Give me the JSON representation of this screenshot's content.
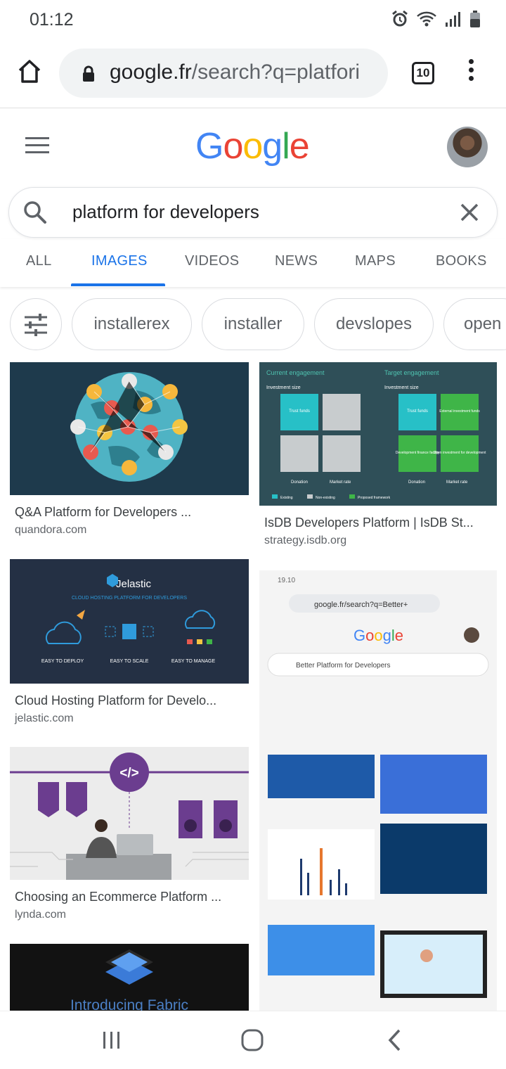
{
  "status": {
    "time": "01:12"
  },
  "browser": {
    "url_host": "google.fr",
    "url_path": "/search?q=platfori",
    "tab_count": "10"
  },
  "search": {
    "query": "platform for developers"
  },
  "tabs": [
    {
      "label": "ALL"
    },
    {
      "label": "IMAGES"
    },
    {
      "label": "VIDEOS"
    },
    {
      "label": "NEWS"
    },
    {
      "label": "MAPS"
    },
    {
      "label": "BOOKS"
    }
  ],
  "chips": [
    {
      "label": "installerex"
    },
    {
      "label": "installer"
    },
    {
      "label": "devslopes"
    },
    {
      "label": "open"
    }
  ],
  "results": [
    {
      "title": "Q&A Platform for Developers ...",
      "source": "quandora.com"
    },
    {
      "title": "IsDB Developers Platform | IsDB St...",
      "source": "strategy.isdb.org"
    },
    {
      "title": "Cloud Hosting Platform for Develo...",
      "source": "jelastic.com"
    },
    {
      "title": "Choosing an Ecommerce Platform ...",
      "source": "lynda.com"
    },
    {
      "title": "Introducing Fabric",
      "source": ""
    }
  ],
  "thumb_text": {
    "jelastic_brand": "Jelastic",
    "jelastic_tagline": "CLOUD HOSTING PLATFORM FOR DEVELOPERS",
    "jelastic_deploy": "EASY TO DEPLOY",
    "jelastic_scale": "EASY TO SCALE",
    "jelastic_manage": "EASY TO MANAGE",
    "code_tag": "</>",
    "isdb_current": "Current engagement",
    "isdb_target": "Target engagement",
    "isdb_inv1": "Investment size",
    "isdb_inv2": "Investment size",
    "isdb_trust1": "Trust funds",
    "isdb_trust2": "Trust funds",
    "isdb_external": "External investment funds",
    "isdb_dev": "Development finance facility",
    "isdb_open": "Open investment for development",
    "isdb_donation1": "Donation",
    "isdb_market1": "Market rate",
    "isdb_donation2": "Donation",
    "isdb_market2": "Market rate",
    "isdb_legend1": "Existing",
    "isdb_legend2": "Non-existing",
    "isdb_legend3": "Proposed framework",
    "shot_time": "19.10",
    "shot_url": "google.fr/search?q=Better+",
    "shot_query": "Better Platform for Developers"
  },
  "colors": {
    "accent": "#1a73e8",
    "g_blue": "#4285f4",
    "g_red": "#ea4335",
    "g_yellow": "#fbbc05",
    "g_green": "#34a853"
  }
}
